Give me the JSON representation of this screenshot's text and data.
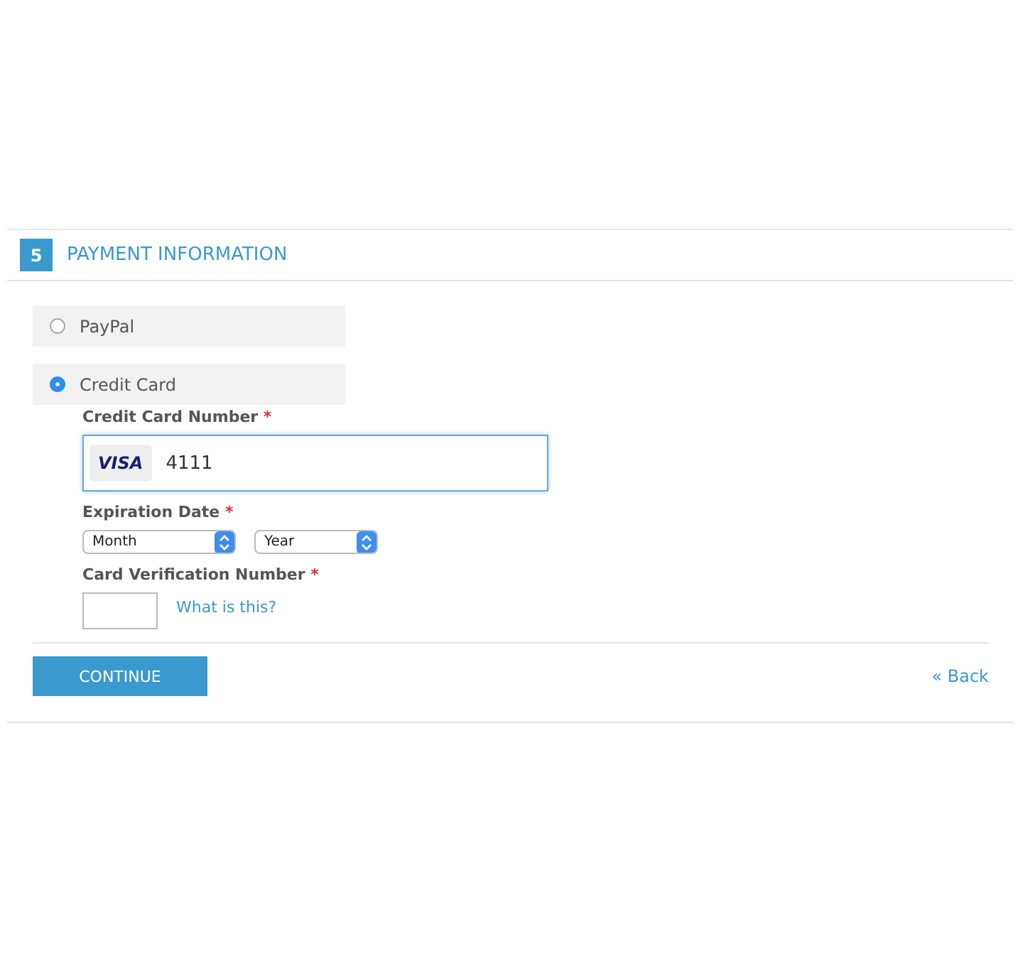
{
  "section": {
    "step": "5",
    "title": "PAYMENT INFORMATION"
  },
  "payment_methods": [
    {
      "label": "PayPal",
      "selected": false
    },
    {
      "label": "Credit Card",
      "selected": true
    }
  ],
  "card_number": {
    "label": "Credit Card Number",
    "required_mark": "*",
    "card_brand": "VISA",
    "value": "4111",
    "focused": true
  },
  "expiration": {
    "label": "Expiration Date",
    "required_mark": "*",
    "month": "Month",
    "year": "Year"
  },
  "cvv": {
    "label": "Card Verification Number",
    "required_mark": "*",
    "help_link": "What is this?"
  },
  "continue_button": "CONTINUE",
  "back_link": "« Back"
}
